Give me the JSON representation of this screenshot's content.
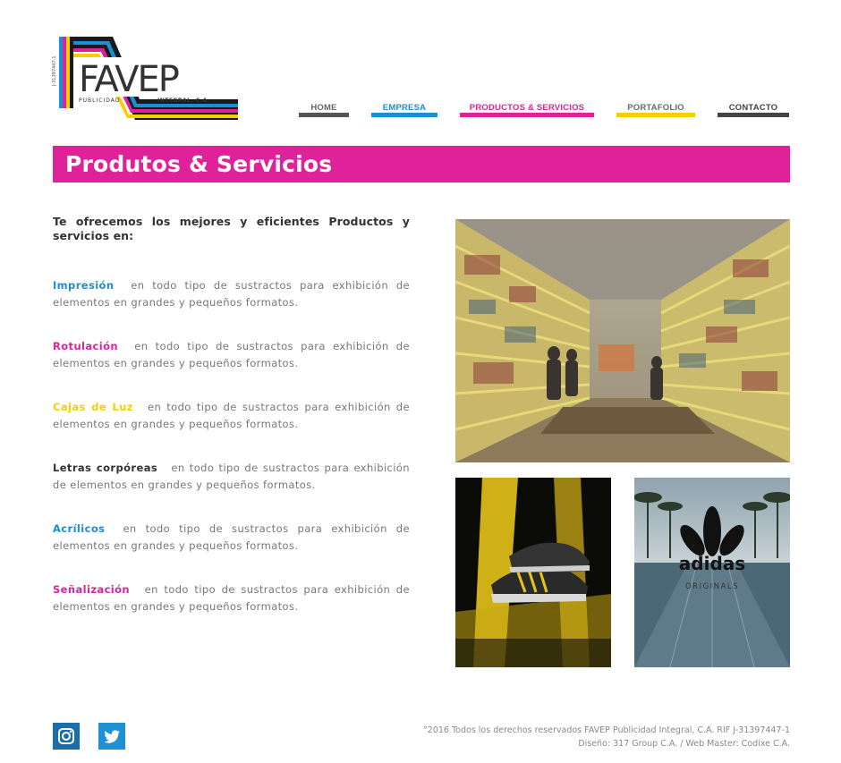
{
  "logo": {
    "main_text": "FAVEP",
    "sub_text": "PUBLICIDAD",
    "sub_text_2": "INTEGRAL, C.A.",
    "rif_text": "J-31397447-1",
    "stripe_colors": [
      "#1a1a1a",
      "#1b8fd0",
      "#e0229a",
      "#f5d000",
      "#1a1a1a"
    ]
  },
  "nav": {
    "items": [
      {
        "label": "HOME",
        "color": "#555555",
        "text_color": "#666666"
      },
      {
        "label": "EMPRESA",
        "color": "#1b8fd0",
        "text_color": "#1b8fd0"
      },
      {
        "label": "PRODUCTOS & SERVICIOS",
        "color": "#e0229a",
        "text_color": "#e0229a"
      },
      {
        "label": "PORTAFOLIO",
        "color": "#f5d000",
        "text_color": "#6a6a6a"
      },
      {
        "label": "CONTACTO",
        "color": "#444444",
        "text_color": "#444444"
      }
    ]
  },
  "banner": {
    "title": "Produtos & Servicios",
    "color": "#e0229a"
  },
  "content": {
    "intro": "Te ofrecemos los mejores y eficientes Productos y servicios en:",
    "items": [
      {
        "term": "Impresión",
        "desc": "en todo tipo de sustractos para exhibición de elementos en grandes y pequeños formatos.",
        "color": "#1b8fd0"
      },
      {
        "term": "Rotulación",
        "desc": "en todo tipo de sustractos para exhibición de elementos en grandes y pequeños formatos.",
        "color": "#e0229a"
      },
      {
        "term": "Cajas de Luz",
        "desc": "en todo tipo de sustractos para exhibición de elementos en grandes y pequeños formatos.",
        "color": "#f5d000"
      },
      {
        "term": "Letras corpóreas",
        "desc": "en todo tipo de sustractos para exhibición de elementos en grandes y pequeños formatos.",
        "color": "#333333"
      },
      {
        "term": "Acrílicos",
        "desc": "en todo tipo de sustractos para exhibición de elementos en grandes y pequeños formatos.",
        "color": "#1b8fd0"
      },
      {
        "term": "Señalización",
        "desc": "en todo tipo de sustractos para exhibición de elementos en grandes y pequeños formatos.",
        "color": "#e0229a"
      }
    ]
  },
  "images": {
    "adidas_brand": "adidas",
    "adidas_sub": "ORIGINALS"
  },
  "footer": {
    "line1": "°2016 Todos los derechos reservados FAVEP Publicidad Integral, C.A. RIF J-31397447-1",
    "line2": "Diseño: 317 Group C.A. / Web Master: Codixe C.A.",
    "social": [
      {
        "name": "instagram-icon"
      },
      {
        "name": "twitter-icon"
      }
    ]
  }
}
